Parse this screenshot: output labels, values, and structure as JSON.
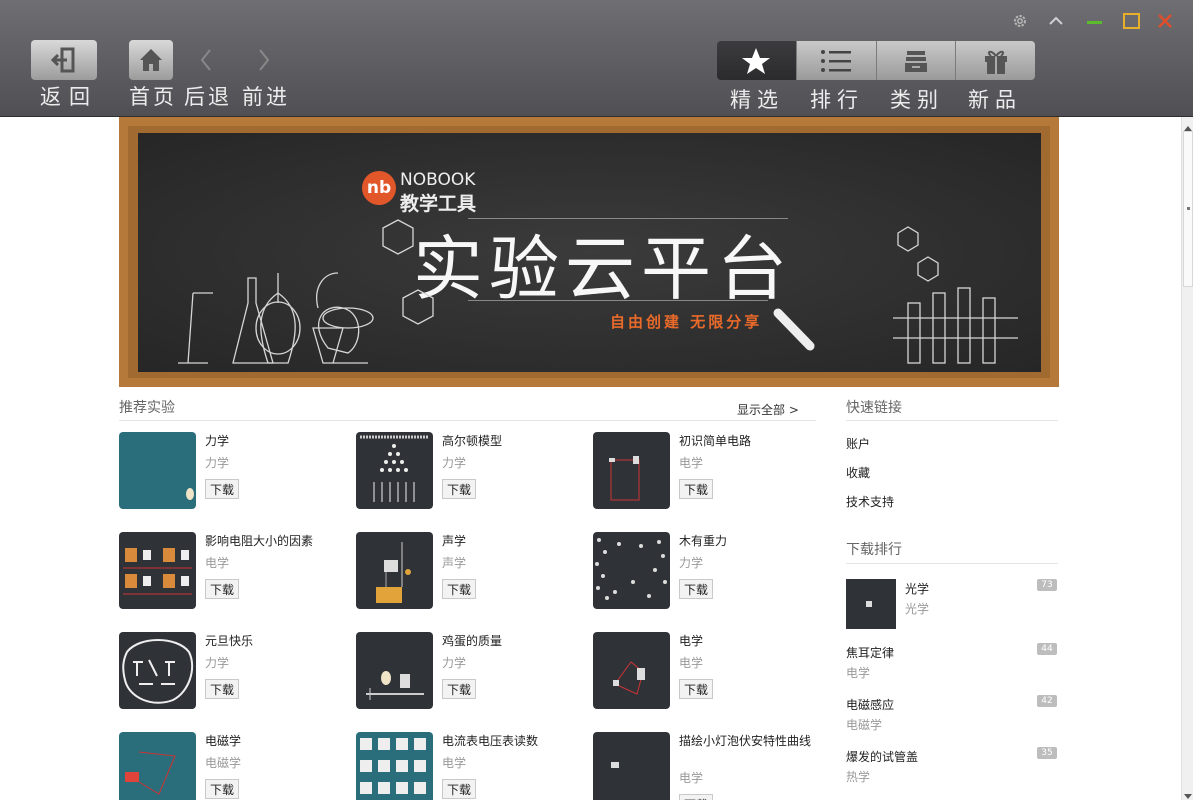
{
  "toolbar": {
    "back_label": "返回",
    "home_label": "首页",
    "prev_label": "后退",
    "next_label": "前进",
    "tabs": [
      "精选",
      "排行",
      "类别",
      "新品"
    ],
    "window_controls": [
      "gear-icon",
      "collapse-icon",
      "minimize-icon",
      "maximize-icon",
      "close-icon"
    ]
  },
  "banner": {
    "logo_mark": "nb",
    "logo_en": "NOBOOK",
    "logo_cn": "教学工具",
    "title": "实验云平台",
    "subtitle": "自由创建 无限分享"
  },
  "recommended": {
    "title": "推荐实验",
    "show_all": "显示全部 >",
    "download_label": "下载",
    "items": [
      {
        "title": "力学",
        "category": "力学"
      },
      {
        "title": "高尔顿模型",
        "category": "力学"
      },
      {
        "title": "初识简单电路",
        "category": "电学"
      },
      {
        "title": "影响电阻大小的因素",
        "category": "电学"
      },
      {
        "title": "声学",
        "category": "声学"
      },
      {
        "title": "木有重力",
        "category": "力学"
      },
      {
        "title": "元旦快乐",
        "category": "力学"
      },
      {
        "title": "鸡蛋的质量",
        "category": "力学"
      },
      {
        "title": "电学",
        "category": "电学"
      },
      {
        "title": "电磁学",
        "category": "电磁学"
      },
      {
        "title": "电流表电压表读数",
        "category": "电学"
      },
      {
        "title": "描绘小灯泡伏安特性曲线",
        "category": "电学"
      }
    ]
  },
  "quick_links": {
    "title": "快速链接",
    "items": [
      "账户",
      "收藏",
      "技术支持"
    ]
  },
  "download_rank": {
    "title": "下载排行",
    "items": [
      {
        "title": "光学",
        "category": "光学",
        "count": "73"
      },
      {
        "title": "焦耳定律",
        "category": "电学",
        "count": "44"
      },
      {
        "title": "电磁感应",
        "category": "电磁学",
        "count": "42"
      },
      {
        "title": "爆发的试管盖",
        "category": "热学",
        "count": "35"
      }
    ]
  },
  "colors": {
    "toolbar_top": "#6f6f73",
    "toolbar_bottom": "#505054",
    "accent_orange": "#e2572a",
    "close_red": "#e04d2b",
    "minimize_green": "#5cbb2b",
    "maximize_yellow": "#e7b02a"
  }
}
